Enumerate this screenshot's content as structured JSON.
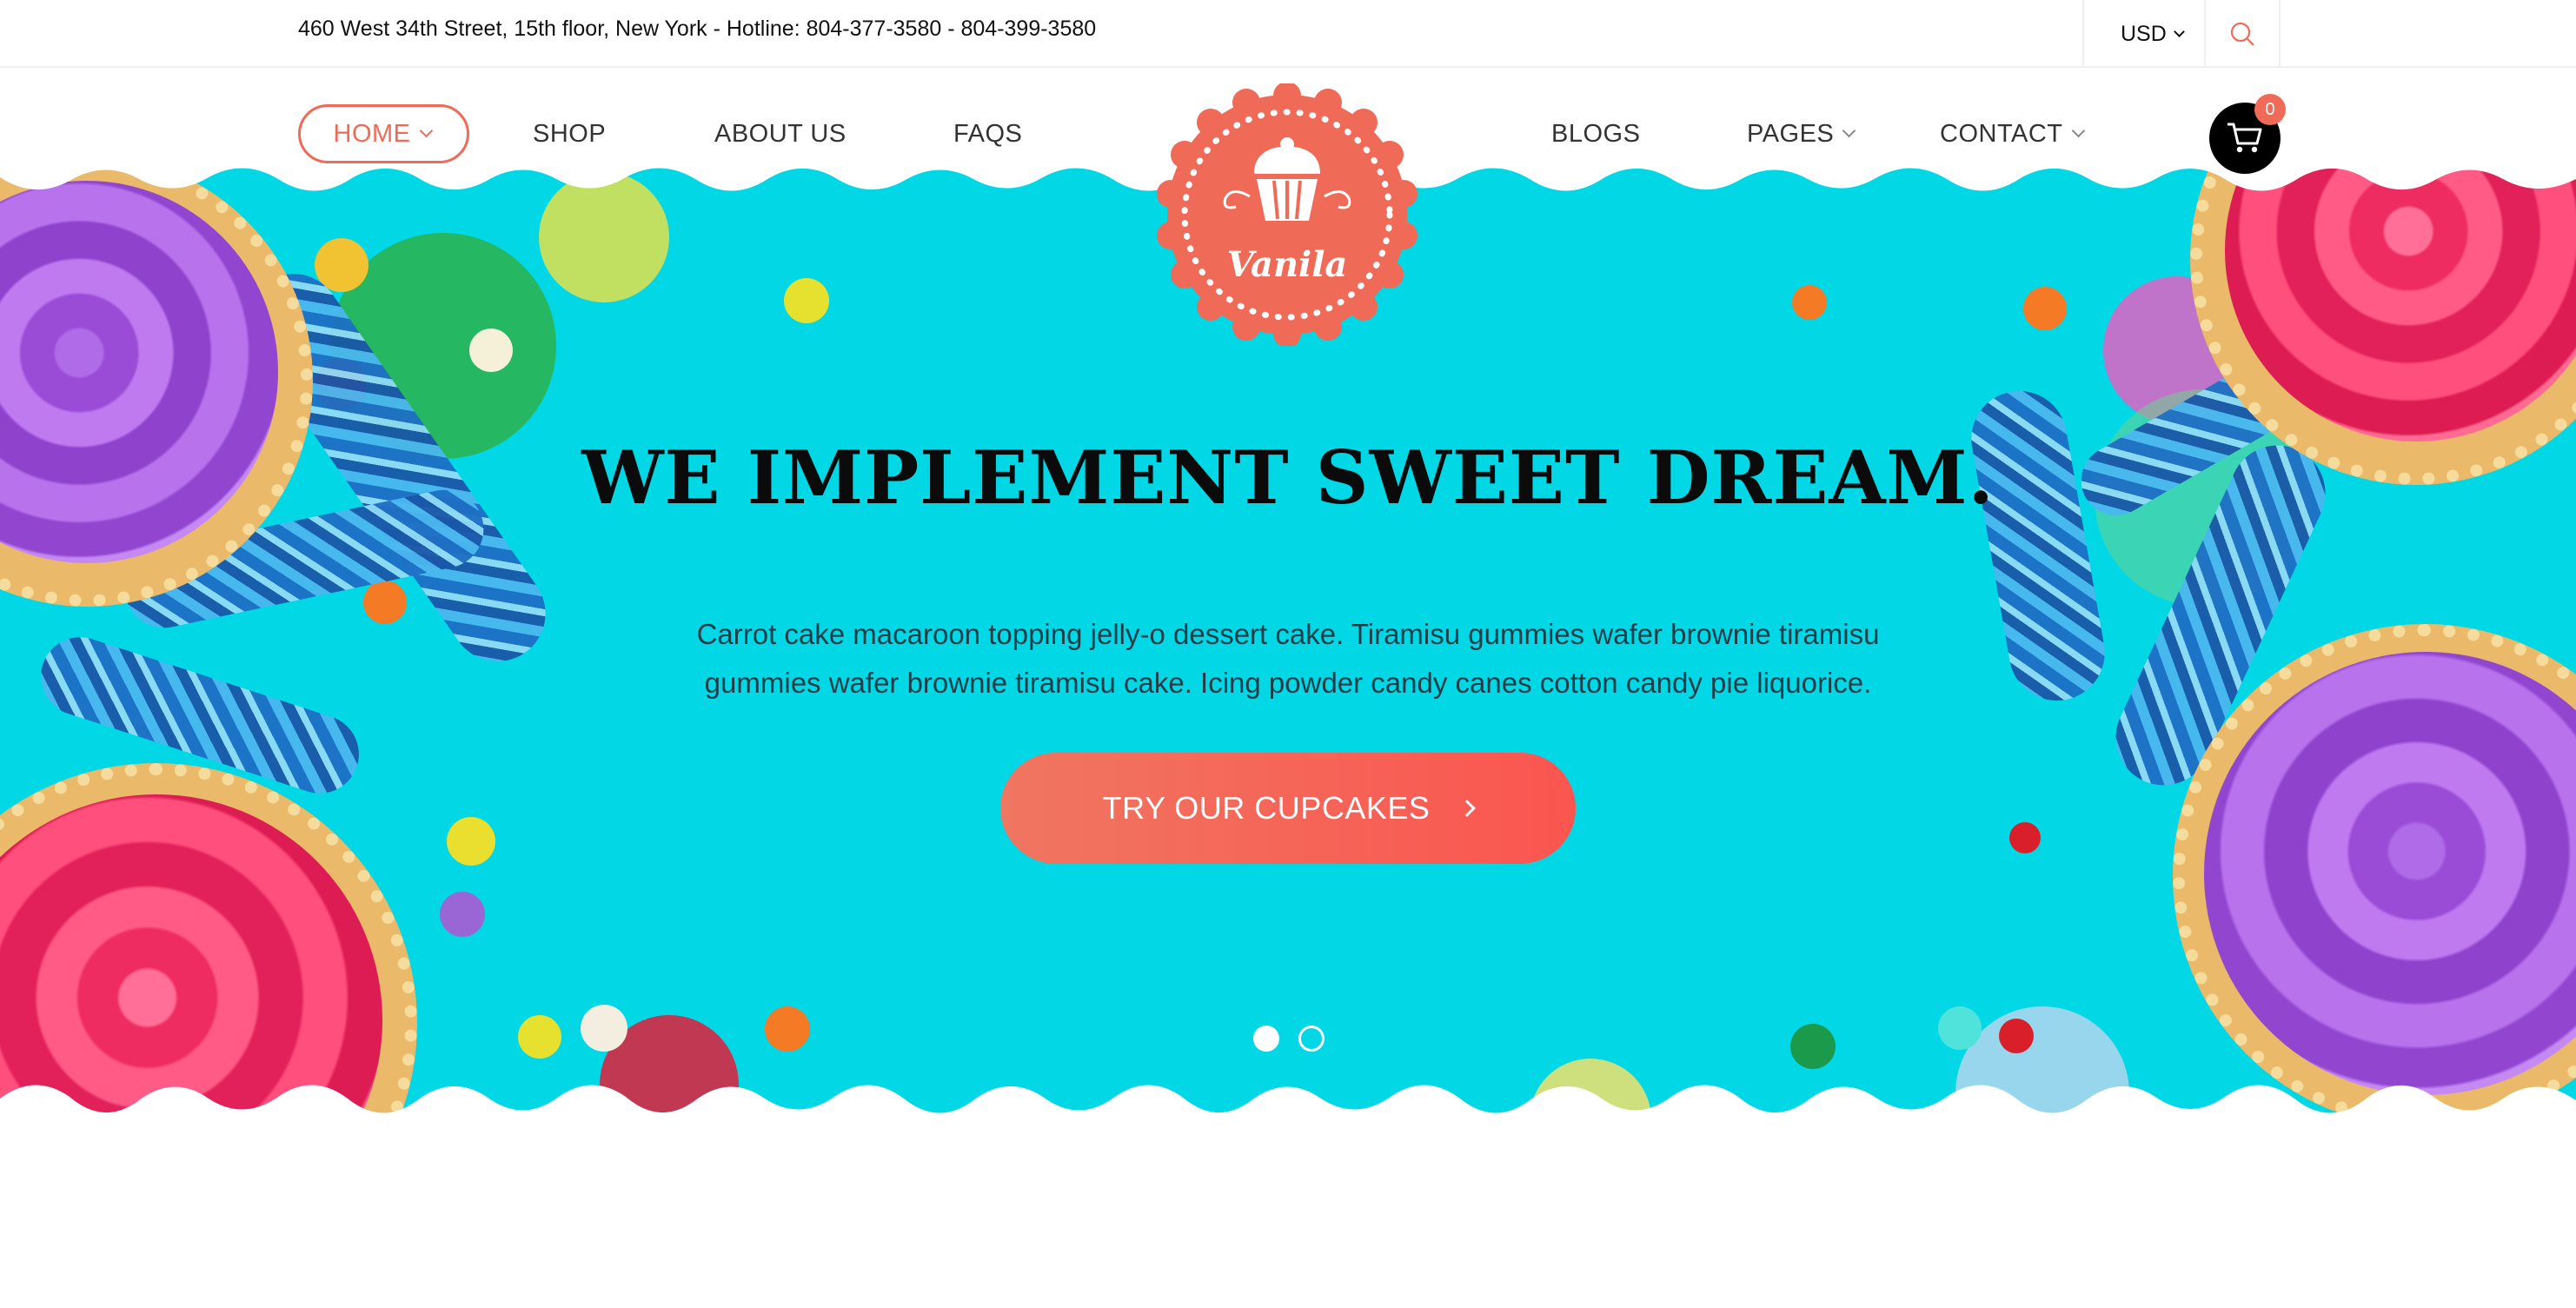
{
  "topbar": {
    "info": "460 West 34th Street, 15th floor, New York - Hotline: 804-377-3580 - 804-399-3580",
    "currency": "USD"
  },
  "nav": {
    "items": [
      {
        "label": "HOME"
      },
      {
        "label": "SHOP"
      },
      {
        "label": "ABOUT US"
      },
      {
        "label": "FAQS"
      },
      {
        "label": "BLOGS"
      },
      {
        "label": "PAGES"
      },
      {
        "label": "CONTACT"
      }
    ],
    "cart_count": "0"
  },
  "logo": {
    "text": "Vanila"
  },
  "hero": {
    "headline": "WE IMPLEMENT SWEET DREAM.",
    "subtext": "Carrot cake macaroon topping jelly-o dessert cake. Tiramisu gummies wafer brownie tiramisu gummies wafer brownie tiramisu cake. Icing powder candy canes cotton candy pie liquorice.",
    "cta_label": "TRY OUR CUPCAKES",
    "slide_count": 2,
    "active_slide": 1
  },
  "colors": {
    "accent": "#f06a58",
    "hero_background": "#02d7e6",
    "text_dark": "#0b0b0b"
  },
  "icons": [
    "search-icon",
    "chevron-down-icon",
    "cart-icon",
    "cupcake-icon",
    "arrow-right-icon"
  ]
}
